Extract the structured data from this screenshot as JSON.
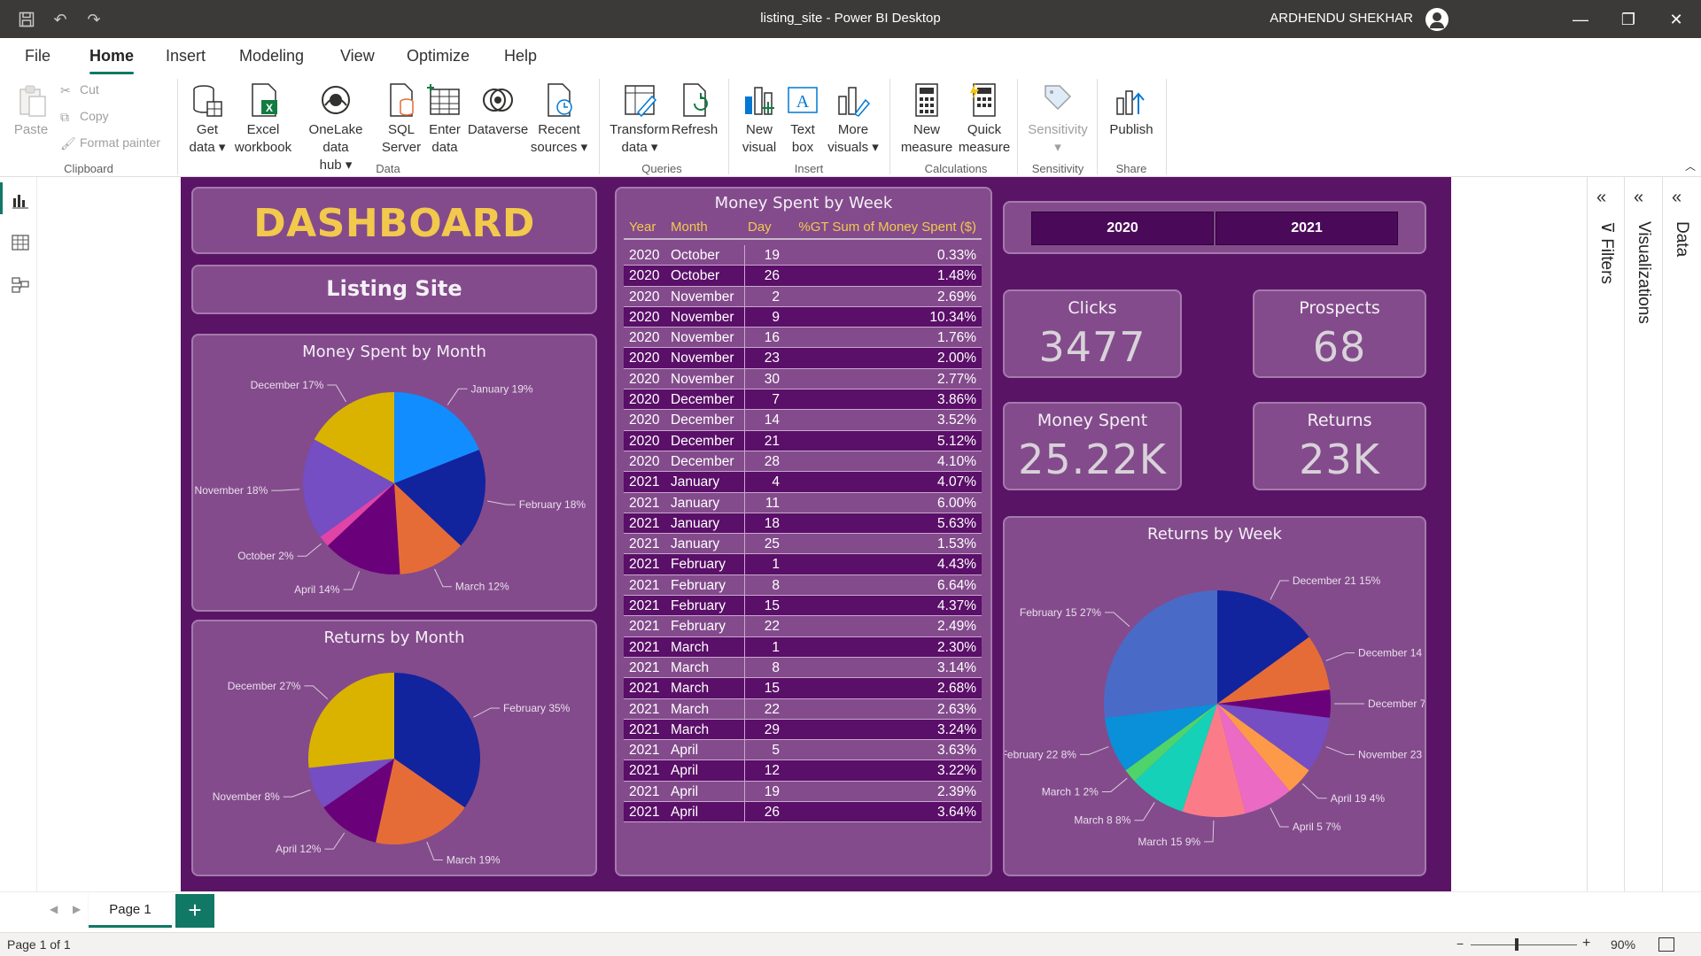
{
  "window": {
    "title": "listing_site - Power BI Desktop",
    "user": "ARDHENDU SHEKHAR"
  },
  "menu": {
    "items": [
      "File",
      "Home",
      "Insert",
      "Modeling",
      "View",
      "Optimize",
      "Help"
    ],
    "active": "Home"
  },
  "ribbon": {
    "clipboard": {
      "paste": "Paste",
      "cut": "Cut",
      "copy": "Copy",
      "format_painter": "Format painter",
      "label": "Clipboard"
    },
    "data": {
      "get_data_1": "Get",
      "get_data_2": "data",
      "excel_1": "Excel",
      "excel_2": "workbook",
      "onelake_1": "OneLake data",
      "onelake_2": "hub",
      "sql_1": "SQL",
      "sql_2": "Server",
      "enter_1": "Enter",
      "enter_2": "data",
      "dataverse": "Dataverse",
      "recent_1": "Recent",
      "recent_2": "sources",
      "label": "Data"
    },
    "queries": {
      "transform_1": "Transform",
      "transform_2": "data",
      "refresh": "Refresh",
      "label": "Queries"
    },
    "insert": {
      "new_visual_1": "New",
      "new_visual_2": "visual",
      "text_box_1": "Text",
      "text_box_2": "box",
      "more_visuals_1": "More",
      "more_visuals_2": "visuals",
      "label": "Insert"
    },
    "calculations": {
      "new_measure_1": "New",
      "new_measure_2": "measure",
      "quick_measure_1": "Quick",
      "quick_measure_2": "measure",
      "label": "Calculations"
    },
    "sensitivity": {
      "button": "Sensitivity",
      "label": "Sensitivity"
    },
    "share": {
      "publish": "Publish",
      "label": "Share"
    }
  },
  "report": {
    "dashboard_title": "DASHBOARD",
    "subtitle": "Listing Site",
    "money_by_month": {
      "title": "Money Spent by Month",
      "slices": [
        {
          "label": "January 19%",
          "value": 19,
          "color": "#118dff"
        },
        {
          "label": "February 18%",
          "value": 18,
          "color": "#12239e"
        },
        {
          "label": "March 12%",
          "value": 12,
          "color": "#e66c37"
        },
        {
          "label": "April 14%",
          "value": 14,
          "color": "#6b007b"
        },
        {
          "label": "October 2%",
          "value": 2,
          "color": "#e044a7"
        },
        {
          "label": "November 18%",
          "value": 18,
          "color": "#744ec2"
        },
        {
          "label": "December 17%",
          "value": 17,
          "color": "#d9b300"
        }
      ]
    },
    "returns_by_month": {
      "title": "Returns by Month",
      "slices": [
        {
          "label": "February 35%",
          "value": 35,
          "color": "#12239e"
        },
        {
          "label": "March 19%",
          "value": 19,
          "color": "#e66c37"
        },
        {
          "label": "April 12%",
          "value": 12,
          "color": "#6b007b"
        },
        {
          "label": "November 8%",
          "value": 8,
          "color": "#744ec2"
        },
        {
          "label": "December 27%",
          "value": 27,
          "color": "#d9b300"
        }
      ]
    },
    "table": {
      "title": "Money Spent by Week",
      "headers": {
        "year": "Year",
        "month": "Month",
        "day": "Day",
        "pct": "%GT Sum of Money Spent ($)"
      },
      "rows": [
        {
          "year": "2020",
          "month": "October",
          "day": "19",
          "pct": "0.33%"
        },
        {
          "year": "2020",
          "month": "October",
          "day": "26",
          "pct": "1.48%"
        },
        {
          "year": "2020",
          "month": "November",
          "day": "2",
          "pct": "2.69%"
        },
        {
          "year": "2020",
          "month": "November",
          "day": "9",
          "pct": "10.34%"
        },
        {
          "year": "2020",
          "month": "November",
          "day": "16",
          "pct": "1.76%"
        },
        {
          "year": "2020",
          "month": "November",
          "day": "23",
          "pct": "2.00%"
        },
        {
          "year": "2020",
          "month": "November",
          "day": "30",
          "pct": "2.77%"
        },
        {
          "year": "2020",
          "month": "December",
          "day": "7",
          "pct": "3.86%"
        },
        {
          "year": "2020",
          "month": "December",
          "day": "14",
          "pct": "3.52%"
        },
        {
          "year": "2020",
          "month": "December",
          "day": "21",
          "pct": "5.12%"
        },
        {
          "year": "2020",
          "month": "December",
          "day": "28",
          "pct": "4.10%"
        },
        {
          "year": "2021",
          "month": "January",
          "day": "4",
          "pct": "4.07%"
        },
        {
          "year": "2021",
          "month": "January",
          "day": "11",
          "pct": "6.00%"
        },
        {
          "year": "2021",
          "month": "January",
          "day": "18",
          "pct": "5.63%"
        },
        {
          "year": "2021",
          "month": "January",
          "day": "25",
          "pct": "1.53%"
        },
        {
          "year": "2021",
          "month": "February",
          "day": "1",
          "pct": "4.43%"
        },
        {
          "year": "2021",
          "month": "February",
          "day": "8",
          "pct": "6.64%"
        },
        {
          "year": "2021",
          "month": "February",
          "day": "15",
          "pct": "4.37%"
        },
        {
          "year": "2021",
          "month": "February",
          "day": "22",
          "pct": "2.49%"
        },
        {
          "year": "2021",
          "month": "March",
          "day": "1",
          "pct": "2.30%"
        },
        {
          "year": "2021",
          "month": "March",
          "day": "8",
          "pct": "3.14%"
        },
        {
          "year": "2021",
          "month": "March",
          "day": "15",
          "pct": "2.68%"
        },
        {
          "year": "2021",
          "month": "March",
          "day": "22",
          "pct": "2.63%"
        },
        {
          "year": "2021",
          "month": "March",
          "day": "29",
          "pct": "3.24%"
        },
        {
          "year": "2021",
          "month": "April",
          "day": "5",
          "pct": "3.63%"
        },
        {
          "year": "2021",
          "month": "April",
          "day": "12",
          "pct": "3.22%"
        },
        {
          "year": "2021",
          "month": "April",
          "day": "19",
          "pct": "2.39%"
        },
        {
          "year": "2021",
          "month": "April",
          "day": "26",
          "pct": "3.64%"
        }
      ]
    },
    "slicer": {
      "options": [
        "2020",
        "2021"
      ]
    },
    "kpis": {
      "clicks": {
        "label": "Clicks",
        "value": "3477"
      },
      "prospects": {
        "label": "Prospects",
        "value": "68"
      },
      "money_spent": {
        "label": "Money Spent",
        "value": "25.22K"
      },
      "returns": {
        "label": "Returns",
        "value": "23K"
      }
    },
    "returns_by_week": {
      "title": "Returns by Week",
      "slices": [
        {
          "label": "December 21 15%",
          "value": 15,
          "color": "#12239e"
        },
        {
          "label": "December 14 8%",
          "value": 8,
          "color": "#e66c37"
        },
        {
          "label": "December 7 4%",
          "value": 4,
          "color": "#6b007b"
        },
        {
          "label": "November 23 8%",
          "value": 8,
          "color": "#744ec2"
        },
        {
          "label": "April 19 4%",
          "value": 4,
          "color": "#fd9a4a"
        },
        {
          "label": "April 5 7%",
          "value": 7,
          "color": "#ea6ac4"
        },
        {
          "label": "March 15 9%",
          "value": 9,
          "color": "#fb7c88"
        },
        {
          "label": "March 8 8%",
          "value": 8,
          "color": "#15d1b8"
        },
        {
          "label": "March 1 2%",
          "value": 2,
          "color": "#4ed46b"
        },
        {
          "label": "February 22 8%",
          "value": 8,
          "color": "#0a8fd9"
        },
        {
          "label": "February 15 27%",
          "value": 27,
          "color": "#4a6ac8"
        }
      ]
    }
  },
  "panes": {
    "filters": "Filters",
    "visualizations": "Visualizations",
    "data": "Data"
  },
  "pages": {
    "tab": "Page 1",
    "add": "+"
  },
  "status": {
    "page_info": "Page 1 of 1",
    "zoom": "90%"
  }
}
